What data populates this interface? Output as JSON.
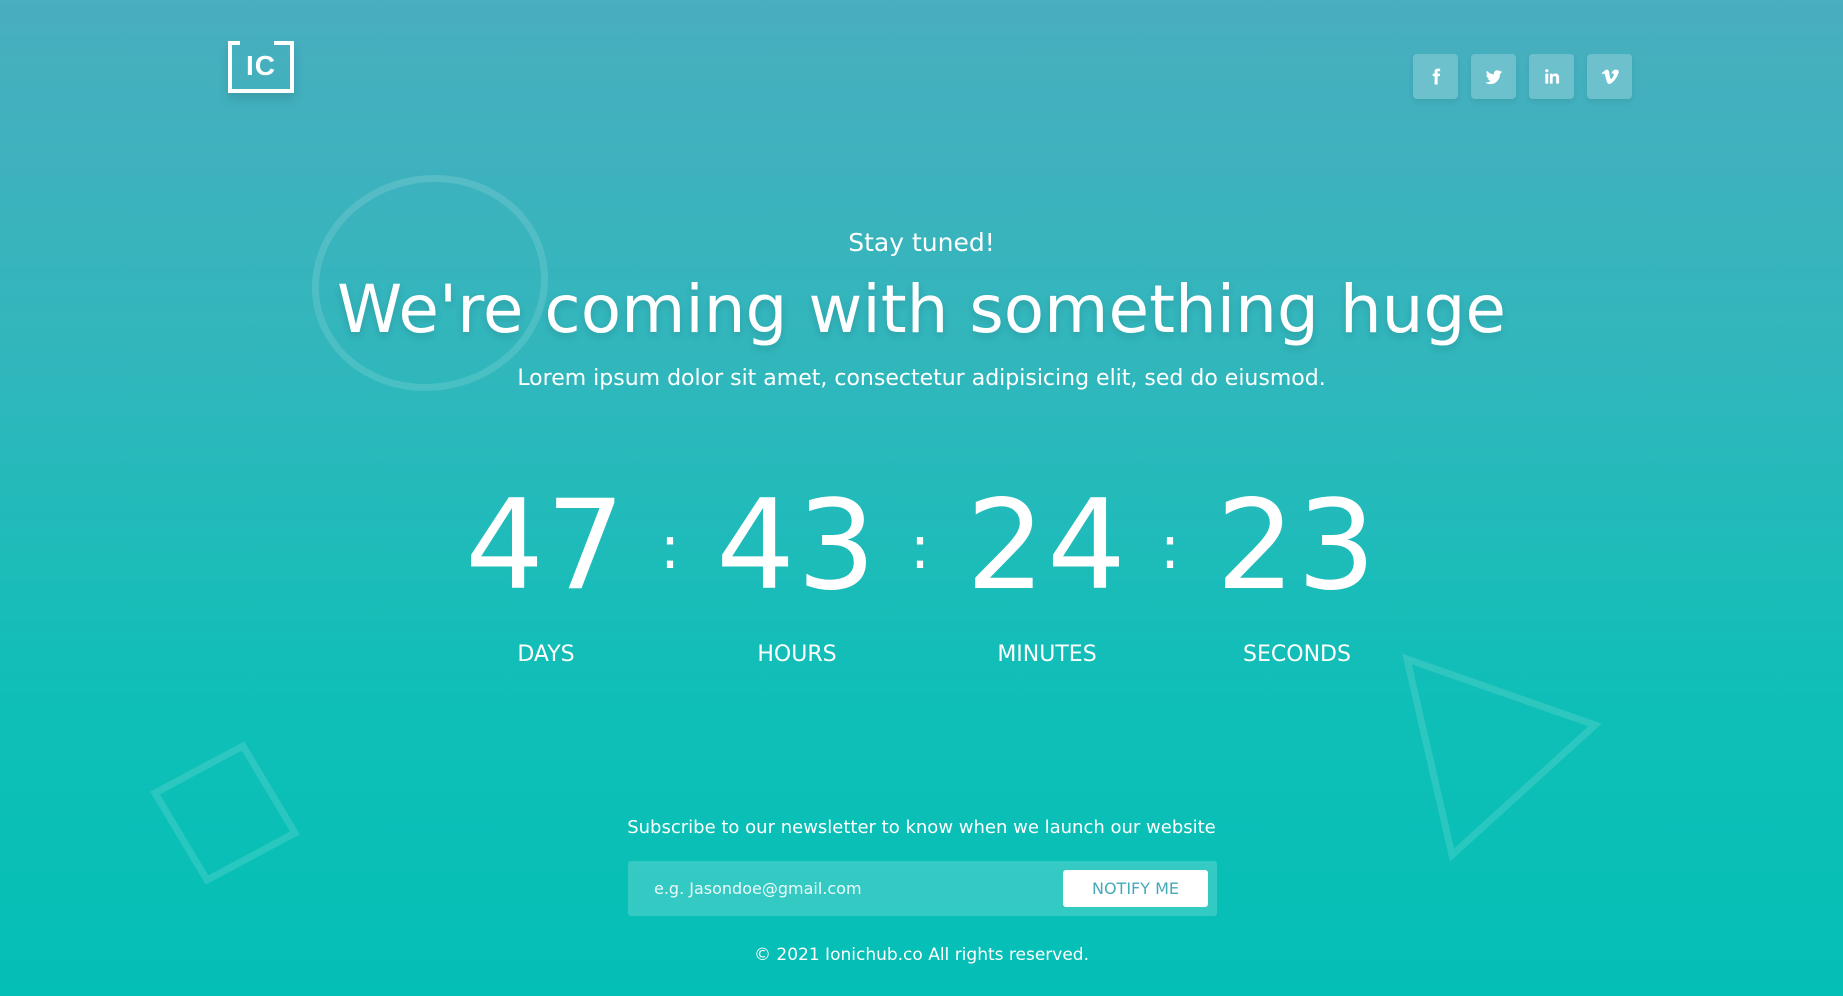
{
  "logo": {
    "text": "IC"
  },
  "socials": [
    {
      "name": "facebook-icon",
      "glyph": "f"
    },
    {
      "name": "twitter-icon",
      "glyph": "t"
    },
    {
      "name": "linkedin-icon",
      "glyph": "in"
    },
    {
      "name": "vimeo-icon",
      "glyph": "v"
    }
  ],
  "hero": {
    "tagline": "Stay tuned!",
    "headline": "We're coming with something huge",
    "subline": "Lorem ipsum dolor sit amet, consectetur adipisicing elit, sed do eiusmod."
  },
  "countdown": {
    "separator": ":",
    "days": {
      "value": "47",
      "label": "DAYS"
    },
    "hours": {
      "value": "43",
      "label": "HOURS"
    },
    "minutes": {
      "value": "24",
      "label": "MINUTES"
    },
    "seconds": {
      "value": "23",
      "label": "SECONDS"
    }
  },
  "newsletter": {
    "text": "Subscribe to our newsletter to know when we launch our website",
    "placeholder": "e.g. Jasondoe@gmail.com",
    "button_label": "NOTIFY ME"
  },
  "footer": {
    "copyright": "© 2021 Ionichub.co All rights reserved."
  },
  "colors": {
    "background_top": "#49aebf",
    "background_bottom": "#04bfb6",
    "button_text": "#46a9b8"
  }
}
